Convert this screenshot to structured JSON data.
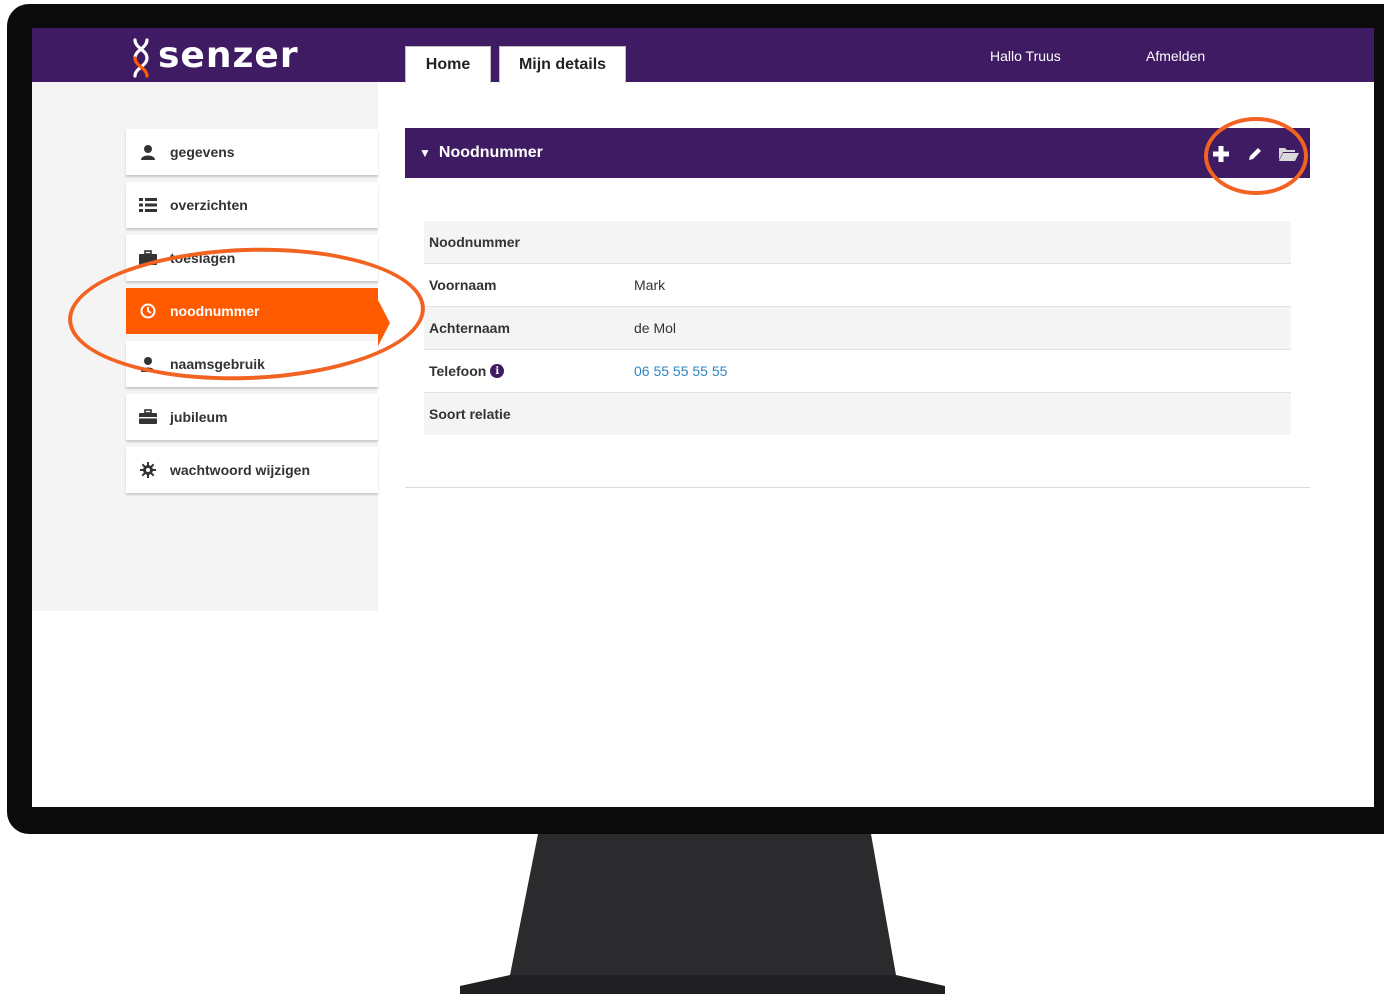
{
  "brand": {
    "logo_text": "senzer"
  },
  "tabs": [
    {
      "label": "Home"
    },
    {
      "label": "Mijn details"
    }
  ],
  "header": {
    "greeting": "Hallo Truus",
    "logout": "Afmelden"
  },
  "sidebar": {
    "items": [
      {
        "label": "gegevens",
        "icon": "user-icon"
      },
      {
        "label": "overzichten",
        "icon": "list-icon"
      },
      {
        "label": "toeslagen",
        "icon": "briefcase-icon"
      },
      {
        "label": "noodnummer",
        "icon": "clock-icon",
        "active": true
      },
      {
        "label": "naamsgebruik",
        "icon": "user-icon"
      },
      {
        "label": "jubileum",
        "icon": "briefcase-icon"
      },
      {
        "label": "wachtwoord wijzigen",
        "icon": "gear-icon"
      }
    ]
  },
  "panel": {
    "title": "Noodnummer",
    "actions": [
      "plus-icon",
      "pencil-icon",
      "folder-open-icon"
    ],
    "rows": [
      {
        "label": "Noodnummer",
        "value": ""
      },
      {
        "label": "Voornaam",
        "value": "Mark"
      },
      {
        "label": "Achternaam",
        "value": "de Mol"
      },
      {
        "label": "Telefoon",
        "value": "06 55 55 55 55"
      },
      {
        "label": "Soort relatie",
        "value": ""
      }
    ]
  },
  "colors": {
    "brand_purple": "#3f1b63",
    "accent_orange": "#ff5a00",
    "annotation_orange": "#f26322",
    "link_blue": "#2f86c0"
  }
}
